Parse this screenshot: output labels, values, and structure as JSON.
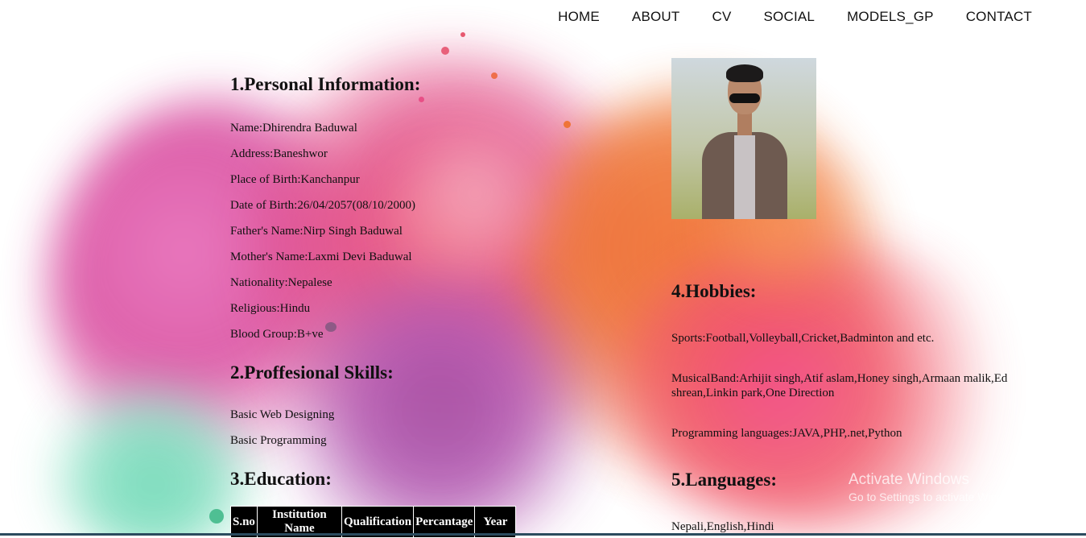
{
  "nav": {
    "items": [
      {
        "label": "HOME"
      },
      {
        "label": "ABOUT"
      },
      {
        "label": "CV"
      },
      {
        "label": "SOCIAL"
      },
      {
        "label": "MODELS_GP"
      },
      {
        "label": "CONTACT"
      }
    ]
  },
  "personal": {
    "heading": "1.Personal Information:",
    "lines": [
      "Name:Dhirendra Baduwal",
      "Address:Baneshwor",
      "Place of Birth:Kanchanpur",
      "Date of Birth:26/04/2057(08/10/2000)",
      "Father's Name:Nirp Singh Baduwal",
      "Mother's Name:Laxmi Devi Baduwal",
      "Nationality:Nepalese",
      "Religious:Hindu",
      "Blood Group:B+ve"
    ]
  },
  "skills": {
    "heading": "2.Proffesional Skills:",
    "lines": [
      "Basic Web Designing",
      "Basic Programming"
    ]
  },
  "education": {
    "heading": "3.Education:",
    "columns": [
      "S.no",
      "Institution Name",
      "Qualification",
      "Percantage",
      "Year"
    ]
  },
  "hobbies": {
    "heading": "4.Hobbies:",
    "sports": "Sports:Football,Volleyball,Cricket,Badminton and etc.",
    "music": "MusicalBand:Arhijit singh,Atif aslam,Honey singh,Armaan malik,Ed shrean,Linkin park,One Direction",
    "programming": "Programming languages:JAVA,PHP,.net,Python"
  },
  "languages": {
    "heading": "5.Languages:",
    "list": "Nepali,English,Hindi"
  },
  "watermark": {
    "title": "Activate Windows",
    "subtitle": "Go to Settings to activate Windows."
  },
  "colors": {
    "background": "#ffffff",
    "table_header_bg": "#000000",
    "text": "#111111"
  }
}
